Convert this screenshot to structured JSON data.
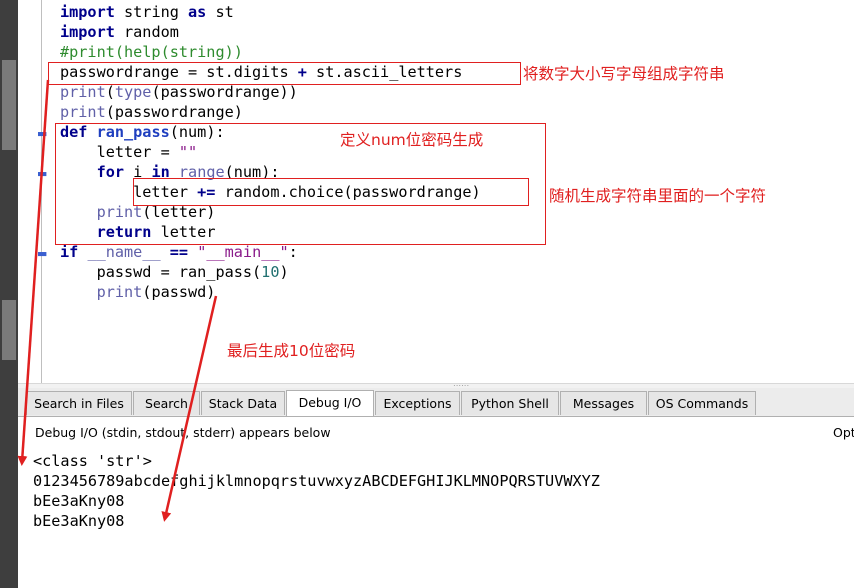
{
  "code": {
    "lines": [
      {
        "id": "l1",
        "tokens": [
          {
            "t": "import",
            "c": "kw"
          },
          {
            "t": " string ",
            "c": ""
          },
          {
            "t": "as",
            "c": "kw"
          },
          {
            "t": " st",
            "c": ""
          }
        ]
      },
      {
        "id": "l2",
        "tokens": [
          {
            "t": "import",
            "c": "kw"
          },
          {
            "t": " random",
            "c": ""
          }
        ]
      },
      {
        "id": "l3",
        "tokens": [
          {
            "t": "#print(help(string))",
            "c": "cm"
          }
        ]
      },
      {
        "id": "l4",
        "tokens": [
          {
            "t": "passwordrange = st.digits ",
            "c": ""
          },
          {
            "t": "+",
            "c": "kw"
          },
          {
            "t": " st.ascii_letters",
            "c": ""
          }
        ]
      },
      {
        "id": "l5",
        "tokens": [
          {
            "t": "print",
            "c": "bi"
          },
          {
            "t": "(",
            "c": ""
          },
          {
            "t": "type",
            "c": "bi"
          },
          {
            "t": "(passwordrange))",
            "c": ""
          }
        ]
      },
      {
        "id": "l6",
        "tokens": [
          {
            "t": "print",
            "c": "bi"
          },
          {
            "t": "(passwordrange)",
            "c": ""
          }
        ]
      },
      {
        "id": "l7",
        "tokens": [
          {
            "t": "def",
            "c": "kw"
          },
          {
            "t": " ",
            "c": ""
          },
          {
            "t": "ran_pass",
            "c": "fn"
          },
          {
            "t": "(num):",
            "c": ""
          }
        ]
      },
      {
        "id": "l8",
        "tokens": [
          {
            "t": "    letter = ",
            "c": ""
          },
          {
            "t": "\"\"",
            "c": "st"
          }
        ]
      },
      {
        "id": "l9",
        "tokens": [
          {
            "t": "    ",
            "c": ""
          },
          {
            "t": "for",
            "c": "kw"
          },
          {
            "t": " i ",
            "c": ""
          },
          {
            "t": "in",
            "c": "kw"
          },
          {
            "t": " ",
            "c": ""
          },
          {
            "t": "range",
            "c": "bi"
          },
          {
            "t": "(num):",
            "c": ""
          }
        ]
      },
      {
        "id": "l10",
        "tokens": [
          {
            "t": "        letter ",
            "c": ""
          },
          {
            "t": "+=",
            "c": "kw"
          },
          {
            "t": " random.choice(passwordrange)",
            "c": ""
          }
        ]
      },
      {
        "id": "l11",
        "tokens": [
          {
            "t": "    ",
            "c": ""
          },
          {
            "t": "print",
            "c": "bi"
          },
          {
            "t": "(letter)",
            "c": ""
          }
        ]
      },
      {
        "id": "l12",
        "tokens": [
          {
            "t": "    ",
            "c": ""
          },
          {
            "t": "return",
            "c": "kw"
          },
          {
            "t": " letter",
            "c": ""
          }
        ]
      },
      {
        "id": "l13",
        "tokens": [
          {
            "t": "if",
            "c": "kw"
          },
          {
            "t": " ",
            "c": ""
          },
          {
            "t": "__name__",
            "c": "bi"
          },
          {
            "t": " ",
            "c": ""
          },
          {
            "t": "==",
            "c": "kw"
          },
          {
            "t": " ",
            "c": ""
          },
          {
            "t": "\"__main__\"",
            "c": "st"
          },
          {
            "t": ":",
            "c": ""
          }
        ]
      },
      {
        "id": "l14",
        "tokens": [
          {
            "t": "    passwd = ran_pass(",
            "c": ""
          },
          {
            "t": "10",
            "c": "num"
          },
          {
            "t": ")",
            "c": ""
          }
        ]
      },
      {
        "id": "l15",
        "tokens": [
          {
            "t": "    ",
            "c": ""
          },
          {
            "t": "print",
            "c": "bi"
          },
          {
            "t": "(passwd)",
            "c": ""
          }
        ]
      }
    ]
  },
  "annotations": {
    "note1": "将数字大小写字母组成字符串",
    "note2": "定义num位密码生成",
    "note3": "随机生成字符串里面的一个字符",
    "note4": "最后生成10位密码"
  },
  "tabs": [
    {
      "label": "Search in Files",
      "active": false
    },
    {
      "label": "Search",
      "active": false
    },
    {
      "label": "Stack Data",
      "active": false
    },
    {
      "label": "Debug I/O",
      "active": true
    },
    {
      "label": "Exceptions",
      "active": false
    },
    {
      "label": "Python Shell",
      "active": false
    },
    {
      "label": "Messages",
      "active": false
    },
    {
      "label": "OS Commands",
      "active": false
    }
  ],
  "debug_panel": {
    "description": "Debug I/O (stdin, stdout, stderr) appears below",
    "options_label": "Opt"
  },
  "output": {
    "lines": [
      "<class 'str'>",
      "0123456789abcdefghijklmnopqrstuvwxyzABCDEFGHIJKLMNOPQRSTUVWXYZ",
      "bEe3aKny08",
      "bEe3aKny08"
    ]
  },
  "colors": {
    "annotation": "#e02020",
    "keyword": "#00008b",
    "comment": "#2e8b2e"
  }
}
